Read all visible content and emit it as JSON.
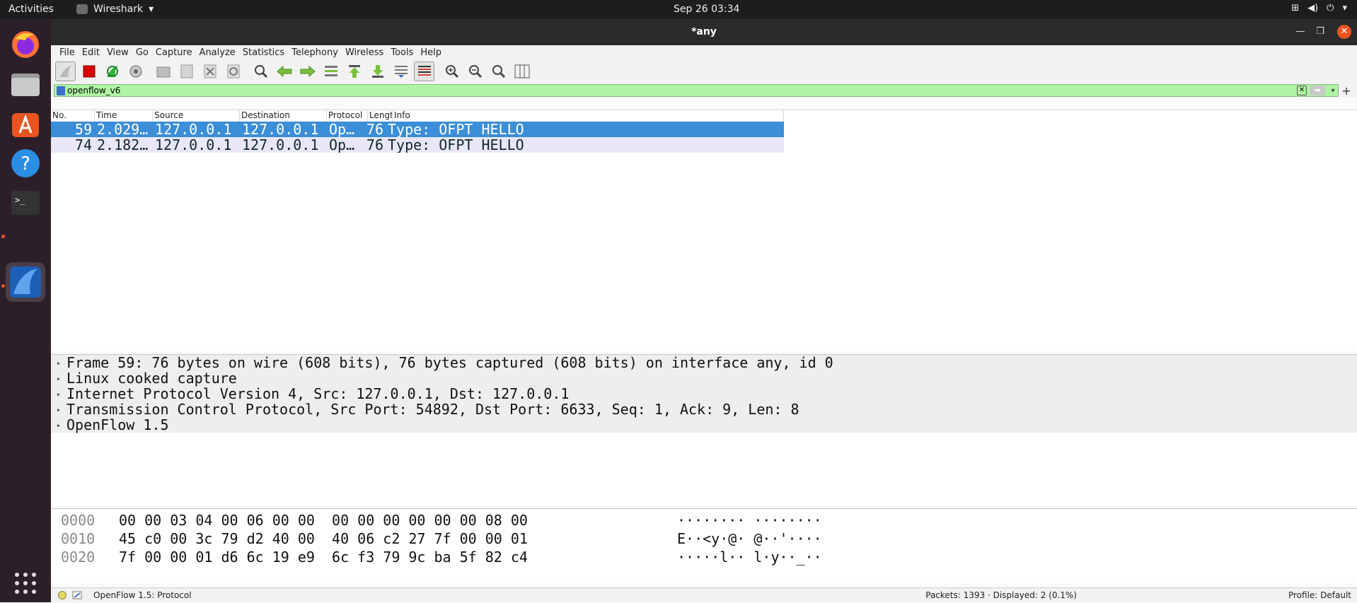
{
  "topbar": {
    "activities": "Activities",
    "app_name": "Wireshark",
    "clock": "Sep 26  03:34"
  },
  "window": {
    "title": "*any"
  },
  "menu": [
    "File",
    "Edit",
    "View",
    "Go",
    "Capture",
    "Analyze",
    "Statistics",
    "Telephony",
    "Wireless",
    "Tools",
    "Help"
  ],
  "filter": {
    "value": "openflow_v6"
  },
  "packet_list": {
    "columns": [
      "No.",
      "Time",
      "Source",
      "Destination",
      "Protocol",
      "Length",
      "Info"
    ],
    "rows": [
      {
        "no": "59",
        "time": "2.029…",
        "src": "127.0.0.1",
        "dst": "127.0.0.1",
        "proto": "Op…",
        "len": "76",
        "info": "Type: OFPT_HELLO"
      },
      {
        "no": "74",
        "time": "2.182…",
        "src": "127.0.0.1",
        "dst": "127.0.0.1",
        "proto": "Op…",
        "len": "76",
        "info": "Type: OFPT_HELLO"
      }
    ]
  },
  "details": [
    "Frame 59: 76 bytes on wire (608 bits), 76 bytes captured (608 bits) on interface any, id 0",
    "Linux cooked capture",
    "Internet Protocol Version 4, Src: 127.0.0.1, Dst: 127.0.0.1",
    "Transmission Control Protocol, Src Port: 54892, Dst Port: 6633, Seq: 1, Ack: 9, Len: 8",
    "OpenFlow 1.5"
  ],
  "bytes": [
    {
      "offset": "0000",
      "hex": "00 00 03 04 00 06 00 00  00 00 00 00 00 00 08 00",
      "ascii": "········ ········"
    },
    {
      "offset": "0010",
      "hex": "45 c0 00 3c 79 d2 40 00  40 06 c2 27 7f 00 00 01",
      "ascii": "E··<y·@· @··'····"
    },
    {
      "offset": "0020",
      "hex": "7f 00 00 01 d6 6c 19 e9  6c f3 79 9c ba 5f 82 c4",
      "ascii": "·····l·· l·y··_··"
    }
  ],
  "status": {
    "protocol": "OpenFlow 1.5: Protocol",
    "packets": "Packets: 1393 · Displayed: 2 (0.1%)",
    "profile": "Profile: Default"
  },
  "colors": {
    "selected_row": "#3b8ed7",
    "filter_valid": "#aff4a4",
    "dock_bg": "#2d1f2a",
    "accent": "#e95420"
  },
  "icons": {
    "dock": [
      "firefox-icon",
      "files-icon",
      "app-center-icon",
      "help-icon",
      "terminal-icon",
      "wireshark-icon",
      "show-apps-icon"
    ],
    "toolbar": [
      "shark-fin-icon",
      "stop-capture-icon",
      "restart-capture-icon",
      "capture-options-icon",
      "open-file-icon",
      "save-file-icon",
      "close-file-icon",
      "reload-file-icon",
      "find-packet-icon",
      "go-back-icon",
      "go-forward-icon",
      "go-to-packet-icon",
      "first-packet-icon",
      "last-packet-icon",
      "autoscroll-icon",
      "colorize-icon",
      "zoom-in-icon",
      "zoom-out-icon",
      "normal-size-icon",
      "resize-columns-icon"
    ]
  }
}
